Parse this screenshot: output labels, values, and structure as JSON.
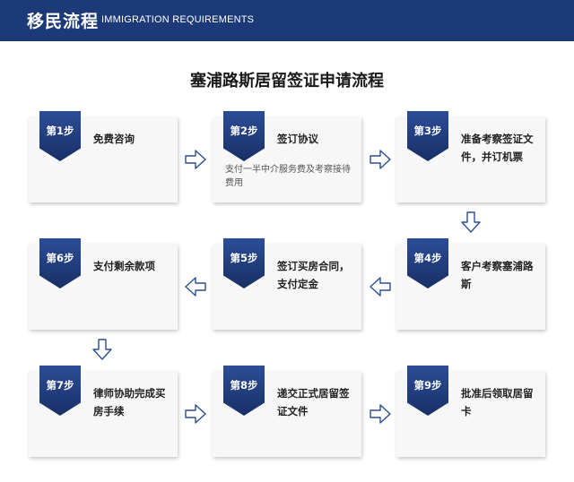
{
  "header": {
    "title_cn": "移民流程",
    "title_en": "IMMIGRATION REQUIREMENTS",
    "bg_color": "#1d3a78"
  },
  "page_title": "塞浦路斯居留签证申请流程",
  "colors": {
    "badge": "#1d3a78",
    "card": "#f7f7f7",
    "arrow": "#2c4d97"
  },
  "steps": [
    {
      "label": "第1步",
      "title": "免费咨询",
      "desc": ""
    },
    {
      "label": "第2步",
      "title": "签订协议",
      "desc": "支付一半中介服务费及考察接待费用"
    },
    {
      "label": "第3步",
      "title": "准备考察签证文件，并订机票",
      "desc": ""
    },
    {
      "label": "第4步",
      "title": "客户考察塞浦路斯",
      "desc": ""
    },
    {
      "label": "第5步",
      "title": "签订买房合同，支付定金",
      "desc": ""
    },
    {
      "label": "第6步",
      "title": "支付剩余款项",
      "desc": ""
    },
    {
      "label": "第7步",
      "title": "律师协助完成买房手续",
      "desc": ""
    },
    {
      "label": "第8步",
      "title": "递交正式居留签证文件",
      "desc": ""
    },
    {
      "label": "第9步",
      "title": "批准后领取居留卡",
      "desc": ""
    }
  ],
  "arrows": [
    "arrow-right",
    "arrow-right",
    "arrow-down",
    "arrow-left",
    "arrow-left",
    "arrow-down",
    "arrow-right",
    "arrow-right"
  ]
}
